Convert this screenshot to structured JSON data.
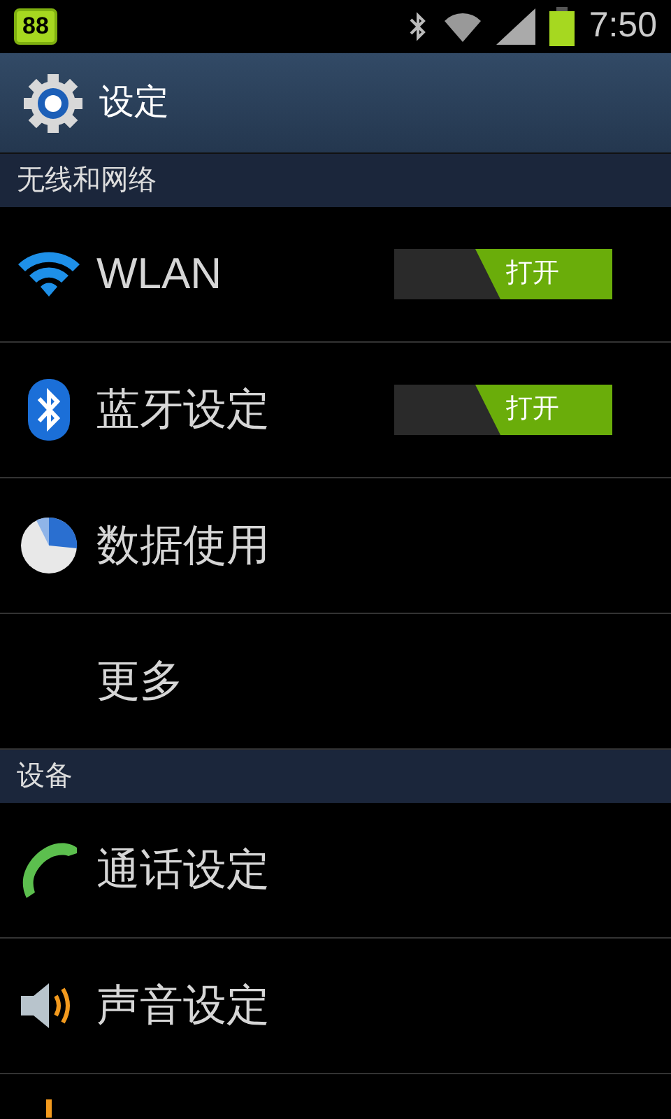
{
  "status_bar": {
    "battery": "88",
    "time": "7:50"
  },
  "header": {
    "title": "设定"
  },
  "sections": [
    {
      "title": "无线和网络",
      "items": [
        {
          "kind": "toggle",
          "label": "WLAN",
          "toggle": {
            "on": true,
            "label": "打开"
          }
        },
        {
          "kind": "toggle",
          "label": "蓝牙设定",
          "toggle": {
            "on": true,
            "label": "打开"
          }
        },
        {
          "kind": "plain",
          "label": "数据使用"
        },
        {
          "kind": "plain",
          "label": "更多"
        }
      ]
    },
    {
      "title": "设备",
      "items": [
        {
          "kind": "plain",
          "label": "通话设定"
        },
        {
          "kind": "plain",
          "label": "声音设定"
        },
        {
          "kind": "partial"
        }
      ]
    }
  ]
}
